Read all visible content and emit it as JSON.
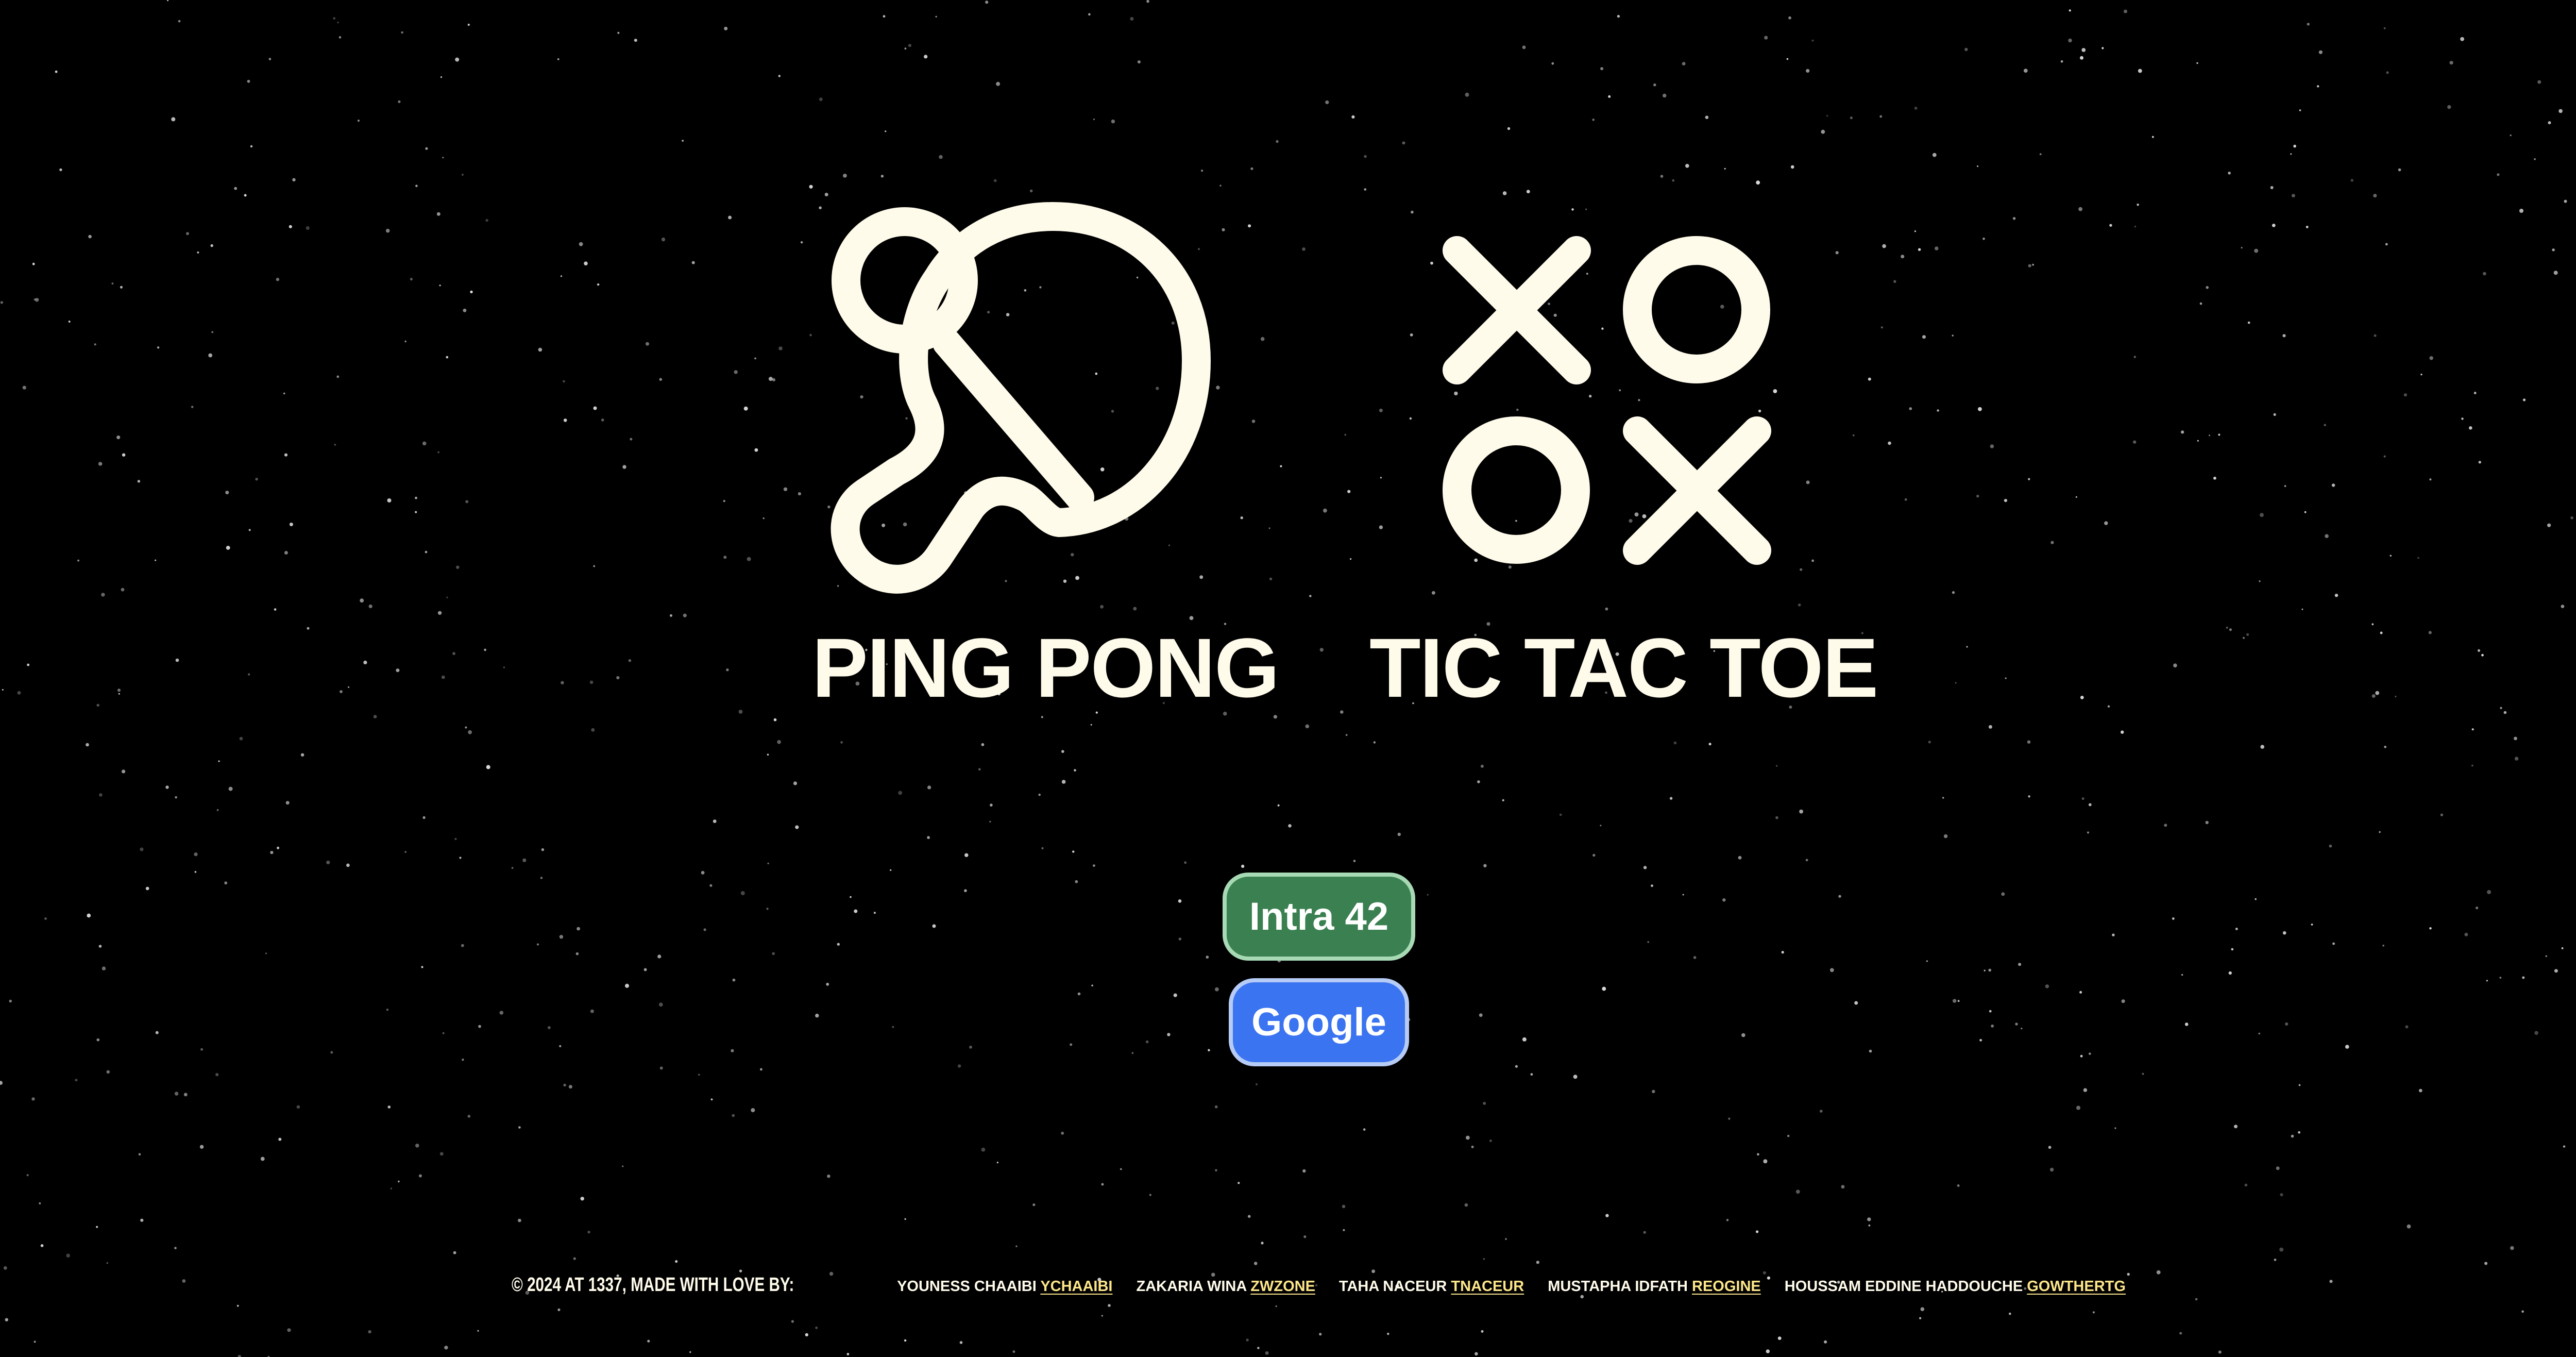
{
  "games": [
    {
      "title": "PING PONG",
      "icon": "ping-pong-paddle-icon"
    },
    {
      "title": "TIC TAC TOE",
      "icon": "tic-tac-toe-icon"
    }
  ],
  "auth": {
    "intra_label": "Intra 42",
    "google_label": "Google"
  },
  "footer": {
    "copyright": "© 2024 AT 1337, MADE WITH LOVE BY:",
    "authors": [
      {
        "name": "YOUNESS CHAAIBI",
        "handle": "YCHAAIBI"
      },
      {
        "name": "ZAKARIA WINA",
        "handle": "ZWZONE"
      },
      {
        "name": "TAHA NACEUR",
        "handle": "TNACEUR"
      },
      {
        "name": "MUSTAPHA IDFATH",
        "handle": "REOGINE"
      },
      {
        "name": "HOUSSAM EDDINE HADDOUCHE",
        "handle": "GOWTHERTG"
      }
    ]
  },
  "colors": {
    "background": "#000000",
    "foreground": "#fffbeb",
    "intra_button": "#3a8050",
    "google_button": "#3b74f0",
    "link": "#fde68a"
  }
}
